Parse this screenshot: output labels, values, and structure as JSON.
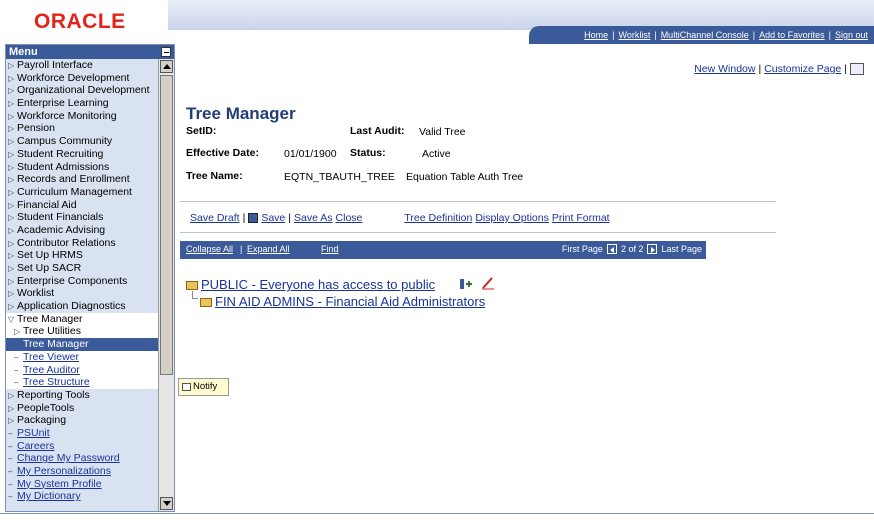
{
  "header": {
    "logo": "ORACLE",
    "nav": [
      "Home",
      "Worklist",
      "MultiChannel Console",
      "Add to Favorites",
      "Sign out"
    ]
  },
  "menu": {
    "title": "Menu",
    "items": [
      {
        "label": "Payroll Interface",
        "kind": "folder"
      },
      {
        "label": "Workforce Development",
        "kind": "folder"
      },
      {
        "label": "Organizational Development",
        "kind": "folder"
      },
      {
        "label": "Enterprise Learning",
        "kind": "folder"
      },
      {
        "label": "Workforce Monitoring",
        "kind": "folder"
      },
      {
        "label": "Pension",
        "kind": "folder"
      },
      {
        "label": "Campus Community",
        "kind": "folder"
      },
      {
        "label": "Student Recruiting",
        "kind": "folder"
      },
      {
        "label": "Student Admissions",
        "kind": "folder"
      },
      {
        "label": "Records and Enrollment",
        "kind": "folder"
      },
      {
        "label": "Curriculum Management",
        "kind": "folder"
      },
      {
        "label": "Financial Aid",
        "kind": "folder"
      },
      {
        "label": "Student Financials",
        "kind": "folder"
      },
      {
        "label": "Academic Advising",
        "kind": "folder"
      },
      {
        "label": "Contributor Relations",
        "kind": "folder"
      },
      {
        "label": "Set Up HRMS",
        "kind": "folder"
      },
      {
        "label": "Set Up SACR",
        "kind": "folder"
      },
      {
        "label": "Enterprise Components",
        "kind": "folder"
      },
      {
        "label": "Worklist",
        "kind": "folder"
      },
      {
        "label": "Application Diagnostics",
        "kind": "folder"
      },
      {
        "label": "Tree Manager",
        "kind": "open"
      },
      {
        "label": "Tree Utilities",
        "kind": "subfolder"
      },
      {
        "label": "Tree Manager",
        "kind": "active"
      },
      {
        "label": "Tree Viewer",
        "kind": "sublink"
      },
      {
        "label": "Tree Auditor",
        "kind": "sublink"
      },
      {
        "label": "Tree Structure",
        "kind": "sublink"
      },
      {
        "label": "Reporting Tools",
        "kind": "folder"
      },
      {
        "label": "PeopleTools",
        "kind": "folder"
      },
      {
        "label": "Packaging",
        "kind": "folder"
      },
      {
        "label": "PSUnit",
        "kind": "link"
      },
      {
        "label": "Careers",
        "kind": "link"
      },
      {
        "label": "Change My Password",
        "kind": "link"
      },
      {
        "label": "My Personalizations",
        "kind": "link"
      },
      {
        "label": "My System Profile",
        "kind": "link"
      },
      {
        "label": "My Dictionary",
        "kind": "link"
      }
    ]
  },
  "toplinks": {
    "new_window": "New Window",
    "customize_page": "Customize Page"
  },
  "page": {
    "title": "Tree Manager",
    "setid_label": "SetID:",
    "last_audit_label": "Last Audit:",
    "last_audit_value": "Valid Tree",
    "eff_date_label": "Effective Date:",
    "eff_date_value": "01/01/1900",
    "status_label": "Status:",
    "status_value": "Active",
    "tree_name_label": "Tree Name:",
    "tree_name_value": "EQTN_TBAUTH_TREE",
    "tree_desc": "Equation Table Auth Tree"
  },
  "actions": {
    "save_draft": "Save Draft",
    "save": "Save",
    "save_as": "Save As",
    "close": "Close",
    "tree_definition": "Tree Definition",
    "display_options": "Display Options",
    "print_format": "Print Format"
  },
  "grid": {
    "collapse_all": "Collapse All",
    "expand_all": "Expand All",
    "find": "Find",
    "first_page": "First Page",
    "page_info": "2 of 2",
    "last_page": "Last Page"
  },
  "tree": {
    "root": "PUBLIC - Everyone has access to public",
    "child": "FIN AID ADMINS - Financial Aid Administrators"
  },
  "notify": "Notify",
  "colors": {
    "brand_red": "#e2231a",
    "nav_blue": "#3b5a9a",
    "title_blue": "#223d7a",
    "link_blue": "#1a3399"
  }
}
